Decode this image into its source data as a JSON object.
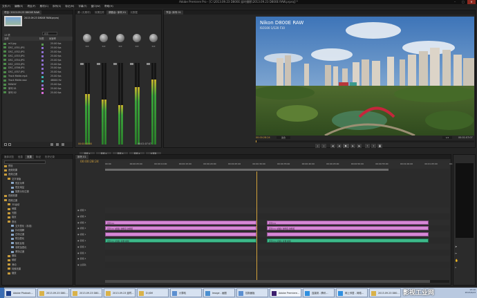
{
  "window": {
    "title": "Adobe Premiere Pro - [C:\\2013.09.23 D800E 延时摄影\\2013.09.23 D800E RAW.prproj] *"
  },
  "menu": [
    "文件(F)",
    "编辑(E)",
    "项目(P)",
    "素材(C)",
    "序列(S)",
    "标记(M)",
    "字幕(T)",
    "窗口(W)",
    "帮助(H)"
  ],
  "project": {
    "tabs": [
      "项目: 2013.09.23 D800E RAW",
      "媒体浏览",
      "信息",
      "效果"
    ],
    "project_name": "2013.09.23 D800E RAW.prproj",
    "item_count": "13 项",
    "search_placeholder": "搜索",
    "columns": [
      "名称",
      "标签",
      "帧速率"
    ],
    "items": [
      {
        "name": "m2.jpg",
        "label_color": "#5a9c50",
        "rate": "25.00 fps"
      },
      {
        "name": "DSC_4351.JPG",
        "label_color": "#8e6fd1",
        "rate": "25.00 fps"
      },
      {
        "name": "DSC_4352.JPG",
        "label_color": "#8e6fd1",
        "rate": "25.00 fps"
      },
      {
        "name": "DSC_4353.JPG",
        "label_color": "#8e6fd1",
        "rate": "25.00 fps"
      },
      {
        "name": "DSC_4354.JPG",
        "label_color": "#8e6fd1",
        "rate": "25.00 fps"
      },
      {
        "name": "DSC_4355.JPG",
        "label_color": "#8e6fd1",
        "rate": "25.00 fps"
      },
      {
        "name": "DSC_4356.JPG",
        "label_color": "#8e6fd1",
        "rate": "25.00 fps"
      },
      {
        "name": "DSC_4357.JPG",
        "label_color": "#8e6fd1",
        "rate": "25.00 fps"
      },
      {
        "name": "Track Matte.mp4",
        "label_color": "#3bb5b5",
        "rate": "25.00 fps"
      },
      {
        "name": "Track Matte.wav",
        "label_color": "#3bb5b5",
        "rate": "48000 Hz"
      },
      {
        "name": "RAW.tif",
        "label_color": "#8e6fd1",
        "rate": "25.00 fps"
      },
      {
        "name": "序列 01",
        "label_color": "#d96bd9",
        "rate": "25.00 fps"
      },
      {
        "name": "序列 02",
        "label_color": "#d96bd9",
        "rate": "25.00 fps"
      }
    ]
  },
  "mixer": {
    "tabs": [
      "源: (无素材)",
      "效果控件",
      "调音台: 序列 01",
      "元数据"
    ],
    "channels": [
      {
        "name": "音频 1",
        "value": "0.0",
        "level": 0.62
      },
      {
        "name": "音频 2",
        "value": "0.0",
        "level": 0.55
      },
      {
        "name": "音频 3",
        "value": "0.0",
        "level": 0.48
      },
      {
        "name": "音频 4",
        "value": "0.0",
        "level": 0.7
      },
      {
        "name": "主音轨",
        "value": "0.0",
        "level": 0.8
      }
    ],
    "timecode_left": "00:00:00:00",
    "timecode_right": "00:01:07:07"
  },
  "monitor": {
    "tab": "节目: 序列 01",
    "overlay_title": "Nikon D800E RAW",
    "overlay_sub": "ISO100  1/120  F10",
    "timecode": "00:00:28:24",
    "duration": "00:01:07:07",
    "zoom": "适合",
    "quality": "1/2"
  },
  "effects": {
    "tabs": [
      "媒体浏览",
      "信息",
      "效果",
      "标记",
      "历史记录"
    ],
    "tree": [
      {
        "name": "预设",
        "indent": 0
      },
      {
        "name": "音频效果",
        "indent": 0
      },
      {
        "name": "音频过渡",
        "indent": 0
      },
      {
        "name": "交叉渐隐",
        "indent": 1
      },
      {
        "name": "恒定功率",
        "indent": 2
      },
      {
        "name": "恒定增益",
        "indent": 2
      },
      {
        "name": "指数淡化过渡",
        "indent": 2
      },
      {
        "name": "视频效果",
        "indent": 0
      },
      {
        "name": "视频过渡",
        "indent": 0
      },
      {
        "name": "3D运动",
        "indent": 1
      },
      {
        "name": "伸展",
        "indent": 1
      },
      {
        "name": "光圈",
        "indent": 1
      },
      {
        "name": "卷页",
        "indent": 1
      },
      {
        "name": "叠化",
        "indent": 1
      },
      {
        "name": "交叉叠化（标准）",
        "indent": 2
      },
      {
        "name": "抖动溶解",
        "indent": 2
      },
      {
        "name": "白场过渡",
        "indent": 2
      },
      {
        "name": "附加叠化",
        "indent": 2
      },
      {
        "name": "随机反相",
        "indent": 2
      },
      {
        "name": "非附加叠化",
        "indent": 2
      },
      {
        "name": "黑场过渡",
        "indent": 2
      },
      {
        "name": "擦除",
        "indent": 1
      },
      {
        "name": "映射",
        "indent": 1
      },
      {
        "name": "滑动",
        "indent": 1
      },
      {
        "name": "特殊效果",
        "indent": 1
      },
      {
        "name": "缩放",
        "indent": 1
      }
    ]
  },
  "timeline": {
    "tab": "序列 01",
    "timecode": "00:00:28:24",
    "ruler": [
      "00:00",
      "00:00:05:00",
      "00:00:10:00",
      "00:00:15:00",
      "00:00:20:00",
      "00:00:25:00",
      "00:00:30:00",
      "00:00:35:00",
      "00:00:40:00",
      "00:00:45:00",
      "00:00:50:00",
      "00:00:55:00",
      "00:01:00:00",
      "00:01:05:00",
      "00:01:10:00"
    ],
    "tracks": [
      {
        "name": "视频 5"
      },
      {
        "name": "视频 4"
      },
      {
        "name": "视频 3"
      },
      {
        "name": "视频 2"
      },
      {
        "name": "视频 1"
      },
      {
        "name": "音频 1"
      },
      {
        "name": "音频 2"
      },
      {
        "name": "音频 3"
      },
      {
        "name": "音频 4"
      },
      {
        "name": "主音轨"
      }
    ],
    "clips": [
      {
        "track": "视频 3",
        "label": "序列 01",
        "start": 0,
        "end": 0.44
      },
      {
        "track": "视频 3",
        "label": "序列 01",
        "start": 0.47,
        "end": 0.94
      },
      {
        "track": "视频 2",
        "label": "序列 01 [视频] 透明度:透明度",
        "start": 0,
        "end": 0.44
      },
      {
        "track": "视频 2",
        "label": "序列 01 [视频] 透明度:透明度",
        "start": 0.47,
        "end": 0.94
      },
      {
        "track": "视频 1",
        "label": "",
        "start": 0,
        "end": 0.44
      },
      {
        "track": "视频 1",
        "label": "",
        "start": 0.47,
        "end": 0.94
      },
      {
        "track": "音频 1",
        "label": "序列 01 [音频] 音量:级别",
        "start": 0,
        "end": 0.44
      },
      {
        "track": "音频 1",
        "label": "序列 01 [音频] 音量:级别",
        "start": 0.47,
        "end": 0.94
      }
    ],
    "playhead": 0.44
  },
  "taskbar": {
    "items": [
      {
        "label": "Adobe Photosh...",
        "color": "#1d3f8a"
      },
      {
        "label": "2013.09.23 D80...",
        "color": "#d9b24a"
      },
      {
        "label": "2013.09.23 D80...",
        "color": "#d9b24a"
      },
      {
        "label": "2013.09.23 延时...",
        "color": "#d9b24a"
      },
      {
        "label": "D:\\SM",
        "color": "#d9b24a"
      },
      {
        "label": "计算机",
        "color": "#5b8fd0"
      },
      {
        "label": "Image - 画图",
        "color": "#4a8fd0"
      },
      {
        "label": "控制面板",
        "color": "#5b8fd0"
      },
      {
        "label": "Adobe Premiere...",
        "color": "#3d1f6e"
      },
      {
        "label": "连接到 - 腾讯...",
        "color": "#2f8fdf"
      },
      {
        "label": "网上邻居 - 网络...",
        "color": "#2f8fdf"
      },
      {
        "label": "2013.09.23 D80...",
        "color": "#d9b24a"
      }
    ],
    "time": "13:10",
    "date": "2013/9/23"
  },
  "watermark": "影视工业网"
}
